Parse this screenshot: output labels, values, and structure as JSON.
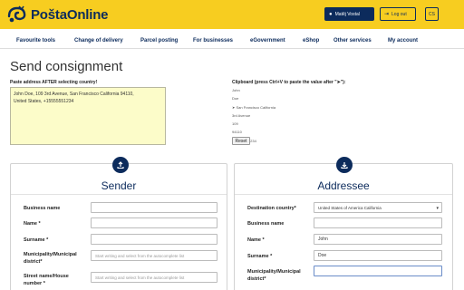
{
  "header": {
    "logo_text": "PoštaOnline",
    "user_label": "Matěj Vostal",
    "logout_label": "Log out",
    "language": "CS"
  },
  "nav": {
    "items": [
      "Favourite tools",
      "Change of delivery",
      "Parcel posting",
      "For businesses",
      "eGovernment",
      "eShop",
      "Other services",
      "My account"
    ]
  },
  "page": {
    "title": "Send consignment"
  },
  "paste": {
    "label": "Paste address AFTER selecting country!",
    "line1": "John Doe, 109 3rd Avenue, San Francisco California 94110,",
    "line2": "United States, +15555551234"
  },
  "clipboard": {
    "title": "Clipboard (press Ctrl+V to paste the value after \"➤\"):",
    "lines": [
      "John",
      "Doe",
      "➤ San Francisco California",
      "3rd Avenue",
      "109",
      "94110",
      "+15555551234"
    ],
    "reset_label": "Reset"
  },
  "sender": {
    "title": "Sender",
    "business_name_label": "Business name",
    "name_label": "Name *",
    "surname_label": "Surname *",
    "municipality_label_1": "Municipality/Municipal",
    "municipality_label_2": "district*",
    "municipality_placeholder": "Start writing and select from the autocomplete list",
    "street_label_1": "Street name/House",
    "street_label_2": "number *",
    "street_placeholder": "Start writing and select from the autocomplete list"
  },
  "addressee": {
    "title": "Addressee",
    "country_label": "Destination country*",
    "country_value": "United States of America California",
    "business_name_label": "Business name",
    "name_label": "Name *",
    "name_value": "John",
    "surname_label": "Surname *",
    "surname_value": "Doe",
    "municipality_label_1": "Municipality/Municipal",
    "municipality_label_2": "district*"
  },
  "colors": {
    "brand_yellow": "#f7cd20",
    "brand_navy": "#0c2b5c",
    "paste_box": "#fcfcc9"
  }
}
